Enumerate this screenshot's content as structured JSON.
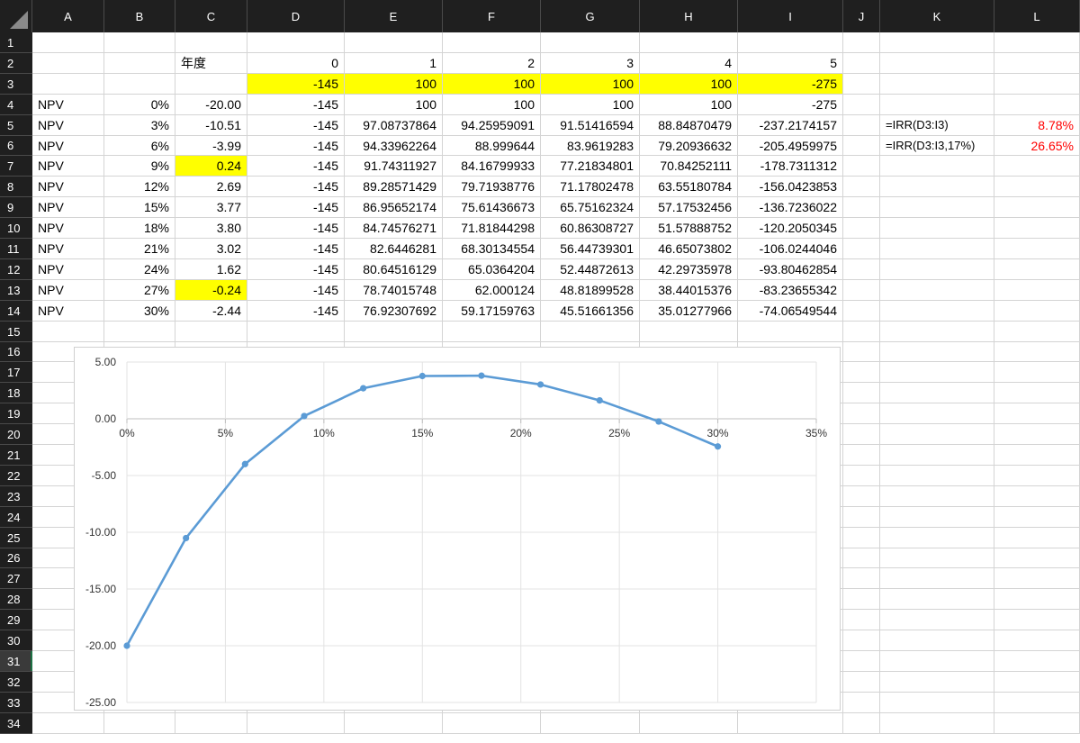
{
  "columns": [
    "A",
    "B",
    "C",
    "D",
    "E",
    "F",
    "G",
    "H",
    "I",
    "J",
    "K",
    "L"
  ],
  "rows": [
    "1",
    "2",
    "3",
    "4",
    "5",
    "6",
    "7",
    "8",
    "9",
    "10",
    "11",
    "12",
    "13",
    "14",
    "15",
    "16",
    "17",
    "18",
    "19",
    "20",
    "21",
    "22",
    "23",
    "24",
    "25",
    "26",
    "27",
    "28",
    "29",
    "30",
    "31",
    "32",
    "33",
    "34"
  ],
  "active_row": "31",
  "cells": {
    "C2": "年度",
    "D2": "0",
    "E2": "1",
    "F2": "2",
    "G2": "3",
    "H2": "4",
    "I2": "5",
    "D3": "-145",
    "E3": "100",
    "F3": "100",
    "G3": "100",
    "H3": "100",
    "I3": "-275",
    "A4": "NPV",
    "B4": "0%",
    "C4": "-20.00",
    "D4": "-145",
    "E4": "100",
    "F4": "100",
    "G4": "100",
    "H4": "100",
    "I4": "-275",
    "A5": "NPV",
    "B5": "3%",
    "C5": "-10.51",
    "D5": "-145",
    "E5": "97.08737864",
    "F5": "94.25959091",
    "G5": "91.51416594",
    "H5": "88.84870479",
    "I5": "-237.2174157",
    "A6": "NPV",
    "B6": "6%",
    "C6": "-3.99",
    "D6": "-145",
    "E6": "94.33962264",
    "F6": "88.999644",
    "G6": "83.9619283",
    "H6": "79.20936632",
    "I6": "-205.4959975",
    "A7": "NPV",
    "B7": "9%",
    "C7": "0.24",
    "D7": "-145",
    "E7": "91.74311927",
    "F7": "84.16799933",
    "G7": "77.21834801",
    "H7": "70.84252111",
    "I7": "-178.7311312",
    "A8": "NPV",
    "B8": "12%",
    "C8": "2.69",
    "D8": "-145",
    "E8": "89.28571429",
    "F8": "79.71938776",
    "G8": "71.17802478",
    "H8": "63.55180784",
    "I8": "-156.0423853",
    "A9": "NPV",
    "B9": "15%",
    "C9": "3.77",
    "D9": "-145",
    "E9": "86.95652174",
    "F9": "75.61436673",
    "G9": "65.75162324",
    "H9": "57.17532456",
    "I9": "-136.7236022",
    "A10": "NPV",
    "B10": "18%",
    "C10": "3.80",
    "D10": "-145",
    "E10": "84.74576271",
    "F10": "71.81844298",
    "G10": "60.86308727",
    "H10": "51.57888752",
    "I10": "-120.2050345",
    "A11": "NPV",
    "B11": "21%",
    "C11": "3.02",
    "D11": "-145",
    "E11": "82.6446281",
    "F11": "68.30134554",
    "G11": "56.44739301",
    "H11": "46.65073802",
    "I11": "-106.0244046",
    "A12": "NPV",
    "B12": "24%",
    "C12": "1.62",
    "D12": "-145",
    "E12": "80.64516129",
    "F12": "65.0364204",
    "G12": "52.44872613",
    "H12": "42.29735978",
    "I12": "-93.80462854",
    "A13": "NPV",
    "B13": "27%",
    "C13": "-0.24",
    "D13": "-145",
    "E13": "78.74015748",
    "F13": "62.000124",
    "G13": "48.81899528",
    "H13": "38.44015376",
    "I13": "-83.23655342",
    "A14": "NPV",
    "B14": "30%",
    "C14": "-2.44",
    "D14": "-145",
    "E14": "76.92307692",
    "F14": "59.17159763",
    "G14": "45.51661356",
    "H14": "35.01277966",
    "I14": "-74.06549544",
    "K5": "=IRR(D3:I3)",
    "L5": "8.78%",
    "K6": "=IRR(D3:I3,17%)",
    "L6": "26.65%"
  },
  "highlight_color": "#ffff00",
  "result_color": "#ff0000",
  "chart_data": {
    "type": "line",
    "title": "",
    "xlabel": "",
    "ylabel": "",
    "x": [
      0,
      0.03,
      0.06,
      0.09,
      0.12,
      0.15,
      0.18,
      0.21,
      0.24,
      0.27,
      0.3
    ],
    "series": [
      {
        "values": [
          -20.0,
          -10.51,
          -3.99,
          0.24,
          2.69,
          3.77,
          3.8,
          3.02,
          1.62,
          -0.24,
          -2.44
        ]
      }
    ],
    "xlim": [
      0,
      0.35
    ],
    "ylim": [
      -25,
      5
    ],
    "x_ticks": [
      "0%",
      "5%",
      "10%",
      "15%",
      "20%",
      "25%",
      "30%",
      "35%"
    ],
    "x_tick_values": [
      0,
      0.05,
      0.1,
      0.15,
      0.2,
      0.25,
      0.3,
      0.35
    ],
    "y_ticks": [
      "5.00",
      "0.00",
      "-5.00",
      "-10.00",
      "-15.00",
      "-20.00",
      "-25.00"
    ],
    "y_tick_values": [
      5,
      0,
      -5,
      -10,
      -15,
      -20,
      -25
    ],
    "grid": true,
    "legend": "none",
    "line_color": "#5b9bd5"
  }
}
